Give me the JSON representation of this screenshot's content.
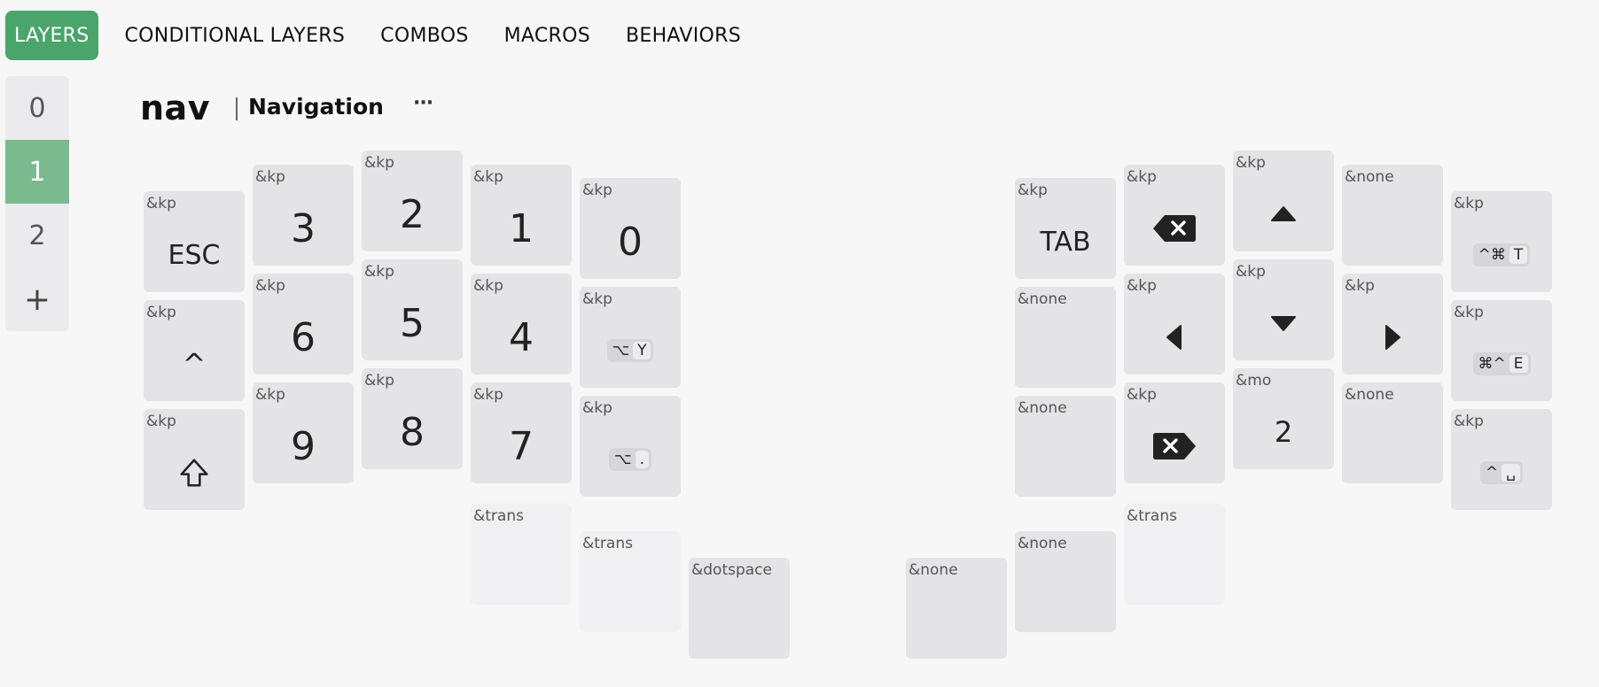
{
  "tabs": [
    "LAYERS",
    "CONDITIONAL LAYERS",
    "COMBOS",
    "MACROS",
    "BEHAVIORS"
  ],
  "layers": [
    "0",
    "1",
    "2"
  ],
  "add_layer_icon": "+",
  "active_layer": "1",
  "layer": {
    "name": "nav",
    "label": "Navigation",
    "menu_icon": "···"
  },
  "keys": {
    "l_esc": {
      "b": "&kp",
      "p": "ESC"
    },
    "l_3": {
      "b": "&kp",
      "p": "3"
    },
    "l_2": {
      "b": "&kp",
      "p": "2"
    },
    "l_1": {
      "b": "&kp",
      "p": "1"
    },
    "l_0": {
      "b": "&kp",
      "p": "0"
    },
    "l_caret": {
      "b": "&kp",
      "p": "^"
    },
    "l_6": {
      "b": "&kp",
      "p": "6"
    },
    "l_5": {
      "b": "&kp",
      "p": "5"
    },
    "l_4": {
      "b": "&kp",
      "p": "4"
    },
    "l_opt_y": {
      "b": "&kp",
      "mod": "⌥",
      "key": "Y"
    },
    "l_shift": {
      "b": "&kp",
      "icon": "shift-icon"
    },
    "l_9": {
      "b": "&kp",
      "p": "9"
    },
    "l_8": {
      "b": "&kp",
      "p": "8"
    },
    "l_7": {
      "b": "&kp",
      "p": "7"
    },
    "l_opt_dot": {
      "b": "&kp",
      "mod": "⌥",
      "key": "."
    },
    "l_trans1": {
      "b": "&trans"
    },
    "l_trans2": {
      "b": "&trans"
    },
    "l_dotspace": {
      "b": "&dotspace"
    },
    "r_none_thumb1": {
      "b": "&none"
    },
    "r_none_thumb2": {
      "b": "&none"
    },
    "r_trans": {
      "b": "&trans"
    },
    "r_tab": {
      "b": "&kp",
      "p": "TAB"
    },
    "r_bksp": {
      "b": "&kp",
      "icon": "backspace-icon"
    },
    "r_up": {
      "b": "&kp",
      "icon": "arrow-up-icon"
    },
    "r_none1": {
      "b": "&none"
    },
    "r_ctrl_cmd_t": {
      "b": "&kp",
      "mod": "^⌘",
      "key": "T"
    },
    "r_none2": {
      "b": "&none"
    },
    "r_left": {
      "b": "&kp",
      "icon": "arrow-left-icon"
    },
    "r_down": {
      "b": "&kp",
      "icon": "arrow-down-icon"
    },
    "r_right": {
      "b": "&kp",
      "icon": "arrow-right-icon"
    },
    "r_cmd_ctrl_e": {
      "b": "&kp",
      "mod": "⌘^",
      "key": "E"
    },
    "r_none3": {
      "b": "&none"
    },
    "r_del": {
      "b": "&kp",
      "icon": "delete-forward-icon"
    },
    "r_mo2": {
      "b": "&mo",
      "p": "2"
    },
    "r_none4": {
      "b": "&none"
    },
    "r_ctrl_space": {
      "b": "&kp",
      "mod": "^",
      "key": "␣"
    }
  },
  "colors": {
    "accent": "#4aa56a",
    "active_layer": "#7aba8e",
    "key_bg": "#e4e4e7",
    "trans_key_bg": "#f0f0f2"
  }
}
